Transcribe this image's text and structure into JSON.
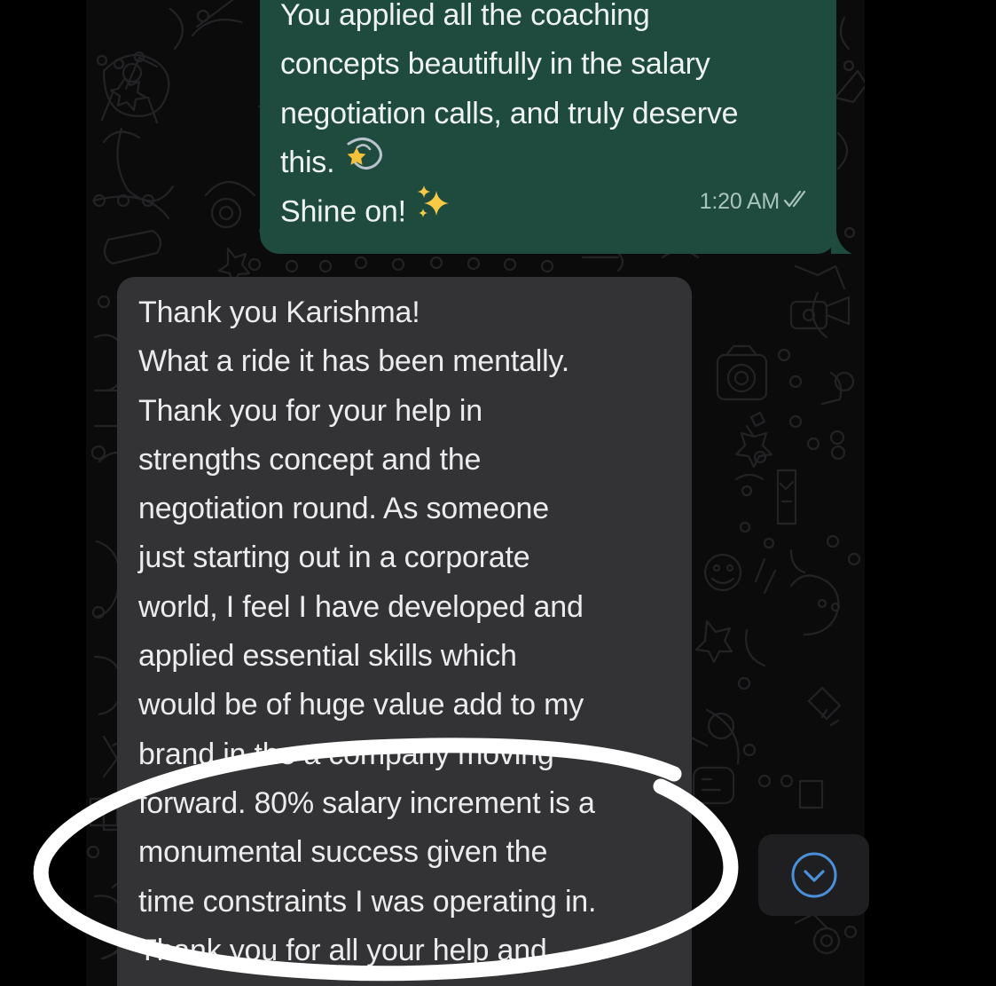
{
  "outgoing_message": {
    "lines": [
      "You applied all the coaching",
      "concepts beautifully in the salary",
      "negotiation calls, and truly deserve",
      "this.",
      "Shine on!"
    ],
    "emoji_line4": "dizzy-icon",
    "emoji_line5": "sparkles-icon",
    "time": "1:20 AM",
    "status_icon": "double-check-icon",
    "bubble_color": "#1f4b3f"
  },
  "incoming_message": {
    "lines": [
      "Thank you Karishma!",
      "What a ride it has been mentally.",
      "Thank you for your help in",
      "strengths concept and the",
      "negotiation round. As someone",
      "just starting out in a corporate",
      "world, I feel I have developed and",
      "applied essential skills which",
      "would be of huge value add to my",
      "brand in the a company moving",
      "forward. 80% salary increment is a",
      "monumental success given the",
      "time constraints I was operating in.",
      "Thank you for all your help and"
    ],
    "bubble_color": "#333336"
  },
  "scroll_button": {
    "icon": "chevron-down-icon",
    "accent": "#4a90d9"
  },
  "annotation": {
    "shape": "ellipse-highlight",
    "color": "#ffffff"
  }
}
